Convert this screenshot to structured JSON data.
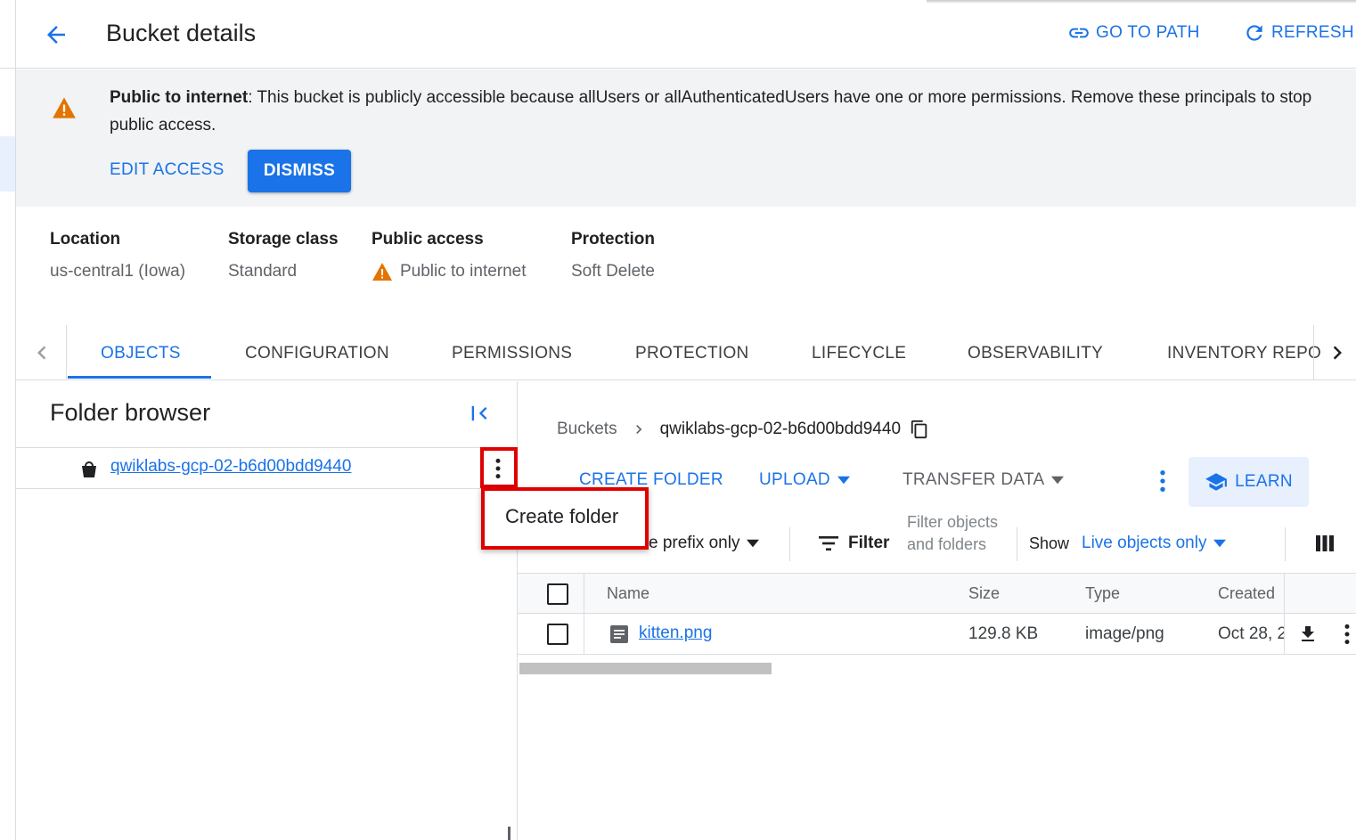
{
  "header": {
    "title": "Bucket details",
    "go_to_path": "GO TO PATH",
    "refresh": "REFRESH"
  },
  "banner": {
    "bold_text": "Public to internet",
    "message": ": This bucket is publicly accessible because allUsers or allAuthenticatedUsers have one or more permissions. Remove these principals to stop public access.",
    "edit_access": "EDIT ACCESS",
    "dismiss": "DISMISS"
  },
  "properties": [
    {
      "label": "Location",
      "value": "us-central1 (Iowa)"
    },
    {
      "label": "Storage class",
      "value": "Standard"
    },
    {
      "label": "Public access",
      "value": "Public to internet"
    },
    {
      "label": "Protection",
      "value": "Soft Delete"
    }
  ],
  "tabs": [
    {
      "label": "OBJECTS",
      "active": true
    },
    {
      "label": "CONFIGURATION"
    },
    {
      "label": "PERMISSIONS"
    },
    {
      "label": "PROTECTION"
    },
    {
      "label": "LIFECYCLE"
    },
    {
      "label": "OBSERVABILITY"
    },
    {
      "label": "INVENTORY REPO"
    }
  ],
  "folder_browser": {
    "title": "Folder browser",
    "bucket_name": "qwiklabs-gcp-02-b6d00bdd9440"
  },
  "breadcrumb": {
    "root": "Buckets",
    "current": "qwiklabs-gcp-02-b6d00bdd9440"
  },
  "toolbar": {
    "create_folder": "CREATE FOLDER",
    "upload": "UPLOAD",
    "transfer_data": "TRANSFER DATA",
    "learn": "LEARN"
  },
  "filter_bar": {
    "prefix_partial": "e prefix only",
    "filter": "Filter",
    "filter_placeholder": "Filter objects and folders",
    "show_label": "Show",
    "show_value": "Live objects only"
  },
  "table": {
    "columns": [
      "Name",
      "Size",
      "Type",
      "Created"
    ],
    "rows": [
      {
        "name": "kitten.png",
        "size": "129.8 KB",
        "type": "image/png",
        "created": "Oct 28, 2"
      }
    ]
  },
  "popup_menu": {
    "item": "Create folder"
  },
  "colors": {
    "accent": "#1a73e8",
    "warning": "#e37400",
    "highlight": "#e00000"
  }
}
